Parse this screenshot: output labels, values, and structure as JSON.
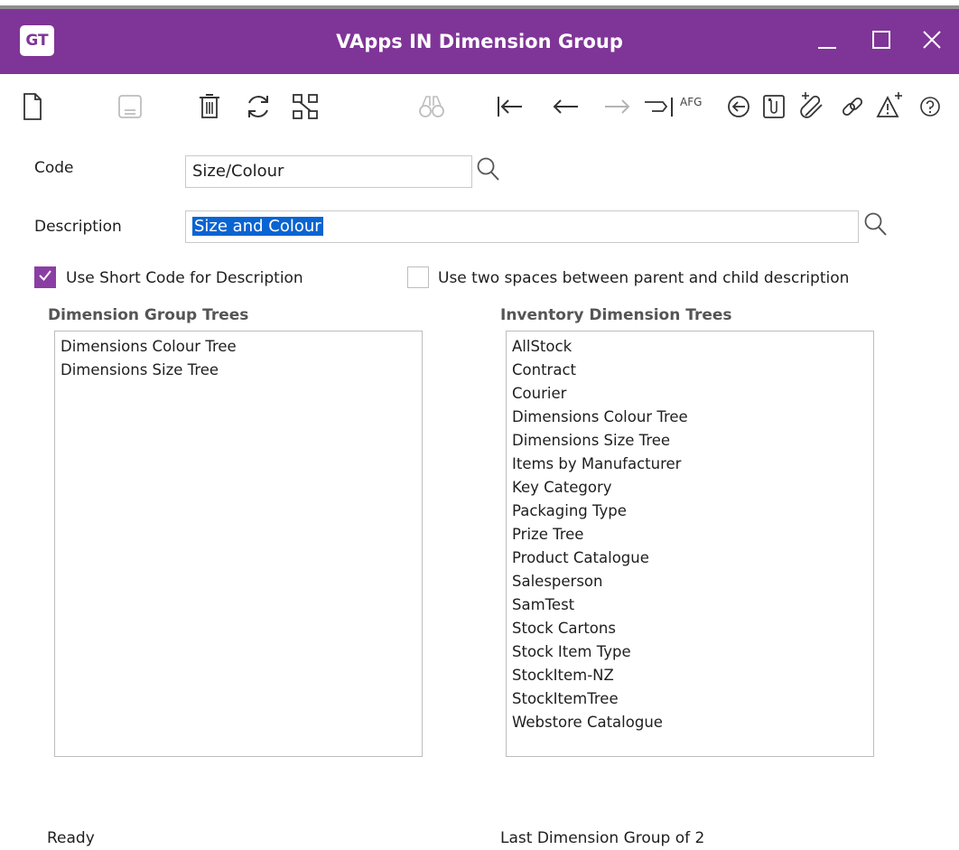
{
  "window": {
    "logo": "GT",
    "title": "VApps IN Dimension Group",
    "minimize_icon": "minimize-icon",
    "maximize_icon": "maximize-icon",
    "close_icon": "close-icon"
  },
  "toolbar": {
    "icons": [
      "new-document-icon",
      "save-icon",
      "delete-icon",
      "refresh-icon",
      "organize-icon",
      "find-icon",
      "first-record-icon",
      "previous-record-icon",
      "next-record-icon",
      "last-record-icon",
      "afg-icon",
      "back-circle-icon",
      "attachment-list-icon",
      "add-attachment-icon",
      "link-icon",
      "add-alert-icon",
      "help-icon"
    ],
    "afg_label": "AFG"
  },
  "form": {
    "code_label": "Code",
    "code_value": "Size/Colour",
    "description_label": "Description",
    "description_value": "Size and Colour",
    "use_short_code_label": "Use Short Code for Description",
    "use_short_code_checked": true,
    "two_spaces_label": "Use two spaces between parent and child description",
    "two_spaces_checked": false
  },
  "dimension_group_trees": {
    "title": "Dimension Group Trees",
    "items": [
      "Dimensions Colour Tree",
      "Dimensions Size Tree"
    ]
  },
  "inventory_dimension_trees": {
    "title": "Inventory Dimension Trees",
    "items": [
      "AllStock",
      "Contract",
      "Courier",
      "Dimensions Colour Tree",
      "Dimensions Size Tree",
      "Items by Manufacturer",
      "Key Category",
      "Packaging Type",
      "Prize Tree",
      "Product Catalogue",
      "Salesperson",
      "SamTest",
      "Stock Cartons",
      "Stock Item Type",
      "StockItem-NZ",
      "StockItemTree",
      "Webstore Catalogue"
    ]
  },
  "status": {
    "left": "Ready",
    "right": "Last Dimension Group of 2"
  },
  "colors": {
    "titlebar": "#7f3597",
    "checkbox_checked": "#8a3ea4",
    "selection": "#0a64d2"
  }
}
